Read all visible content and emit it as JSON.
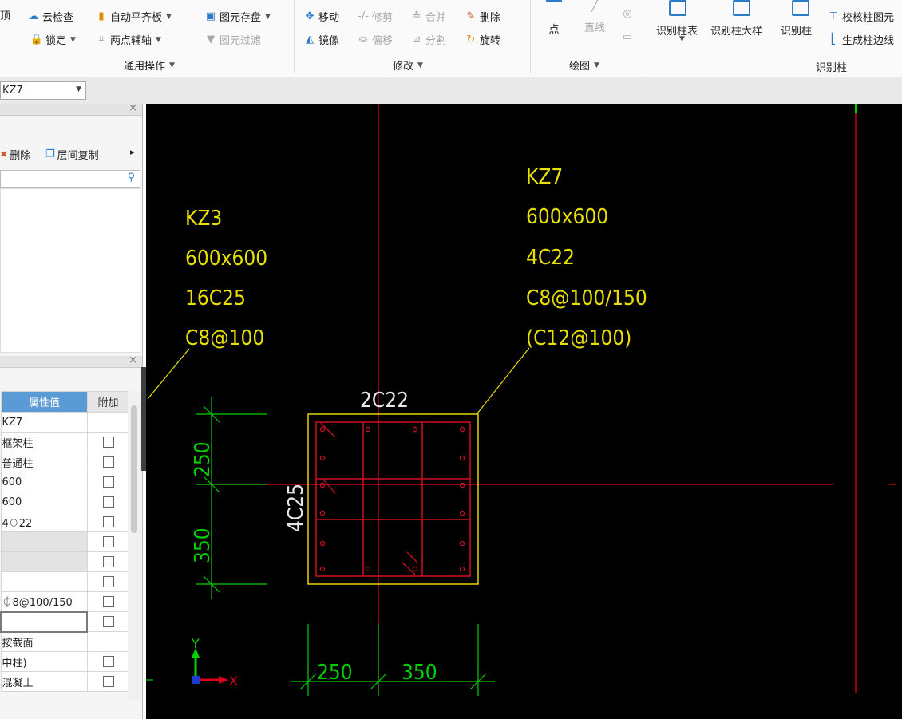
{
  "ribbon": {
    "partial_left_label": "顶",
    "groups": {
      "general": {
        "label": "通用操作",
        "items": [
          {
            "label": "云检查",
            "icon": "cloud-check-icon"
          },
          {
            "label": "自动平齐板",
            "icon": "auto-align-slab-icon"
          },
          {
            "label": "图元存盘",
            "icon": "element-save-icon"
          },
          {
            "label": "锁定",
            "icon": "lock-icon"
          },
          {
            "label": "两点辅轴",
            "icon": "two-point-axis-icon"
          },
          {
            "label": "图元过滤",
            "icon": "filter-icon",
            "disabled": true
          }
        ]
      },
      "modify": {
        "label": "修改",
        "items": [
          {
            "label": "移动",
            "icon": "move-icon"
          },
          {
            "label": "修剪",
            "icon": "trim-icon",
            "disabled": true
          },
          {
            "label": "合并",
            "icon": "merge-icon",
            "disabled": true
          },
          {
            "label": "删除",
            "icon": "delete-icon"
          },
          {
            "label": "镜像",
            "icon": "mirror-icon"
          },
          {
            "label": "偏移",
            "icon": "offset-icon",
            "disabled": true
          },
          {
            "label": "分割",
            "icon": "split-icon",
            "disabled": true
          },
          {
            "label": "旋转",
            "icon": "rotate-icon"
          }
        ]
      },
      "draw": {
        "label": "绘图",
        "items": [
          {
            "label": "点",
            "icon": "point-icon"
          },
          {
            "label": "直线",
            "icon": "line-icon",
            "disabled": true
          }
        ]
      },
      "identify_column": {
        "label": "识别柱",
        "items": [
          {
            "label": "识别柱表",
            "icon": "identify-column-table-icon"
          },
          {
            "label": "识别柱大样",
            "icon": "identify-column-detail-icon"
          },
          {
            "label": "识别柱",
            "icon": "identify-column-icon"
          },
          {
            "label": "校核柱图元",
            "icon": "check-column-icon"
          },
          {
            "label": "生成柱边线",
            "icon": "generate-column-edge-icon"
          }
        ]
      }
    }
  },
  "combo": {
    "value": "KZ7"
  },
  "component_panel": {
    "close": "×",
    "toolbar": {
      "delete": "删除",
      "floor_copy": "层间复制",
      "more": "▸"
    }
  },
  "property_panel": {
    "close": "×",
    "headers": {
      "value": "属性值",
      "extra": "附加"
    },
    "rows": [
      {
        "value": "KZ7",
        "checkbox": false,
        "gray": false
      },
      {
        "value": "框架柱",
        "checkbox": true,
        "gray": false
      },
      {
        "value": "普通柱",
        "checkbox": true,
        "gray": false
      },
      {
        "value": "600",
        "checkbox": true,
        "gray": false
      },
      {
        "value": "600",
        "checkbox": true,
        "gray": false
      },
      {
        "value": "4⏀22",
        "checkbox": true,
        "gray": false
      },
      {
        "value": "",
        "checkbox": true,
        "gray": true
      },
      {
        "value": "",
        "checkbox": true,
        "gray": true
      },
      {
        "value": "",
        "checkbox": true,
        "gray": false
      },
      {
        "value": "⏀8@100/150",
        "checkbox": true,
        "gray": false
      },
      {
        "value": "",
        "checkbox": true,
        "gray": false,
        "editing": true
      },
      {
        "value": "按截面",
        "checkbox": false,
        "gray": false
      },
      {
        "value": "中柱)",
        "checkbox": true,
        "gray": false
      },
      {
        "value": "混凝土",
        "checkbox": true,
        "gray": false
      }
    ]
  },
  "cad": {
    "colors": {
      "background": "#000000",
      "axis_red": "#e0001a",
      "text_yellow": "#e8e000",
      "dim_green": "#00d000",
      "rebar_red": "#cc1020",
      "column_outline": "#e8d300",
      "white_text": "#e6e6e6"
    },
    "kz3_labels": [
      "KZ3",
      "600x600",
      "16C25",
      "C8@100"
    ],
    "kz7_labels": [
      "KZ7",
      "600x600",
      "4C22",
      "C8@100/150",
      "(C12@100)"
    ],
    "top_rebar": "2C22",
    "side_rebar": "4C25",
    "dims_vertical": [
      "250",
      "350"
    ],
    "dims_horizontal": [
      "250",
      "350"
    ],
    "axis_y": "Y",
    "axis_x": "X"
  }
}
